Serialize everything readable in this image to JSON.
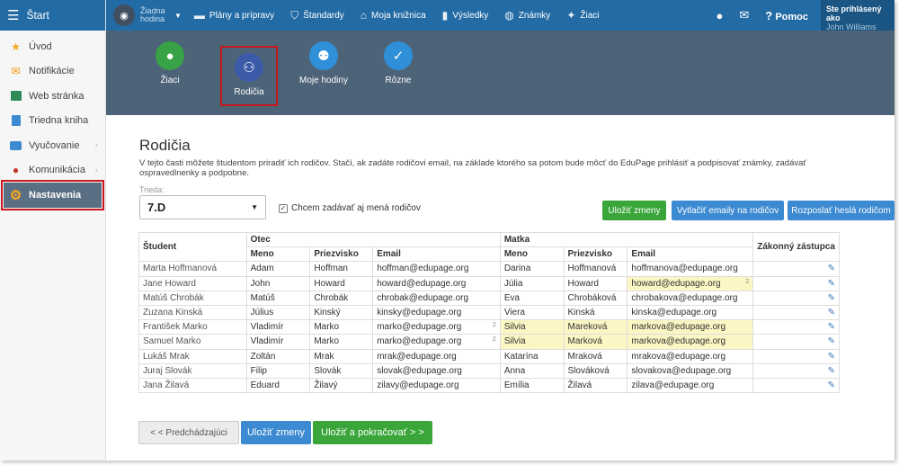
{
  "topbar": {
    "start": "Štart",
    "hour": "Žiadna hodina",
    "menu": [
      "Plány a prípravy",
      "Štandardy",
      "Moja knižnica",
      "Výsledky",
      "Známky",
      "Žiaci"
    ],
    "help": "Pomoc",
    "user_line1": "Ste prihlásený ako",
    "user_name": "John Williams"
  },
  "sidebar": {
    "items": [
      {
        "label": "Úvod",
        "icon": "star-icon",
        "color": "#f5a623"
      },
      {
        "label": "Notifikácie",
        "icon": "envelope-icon",
        "color": "#f39c12"
      },
      {
        "label": "Web stránka",
        "icon": "home-icon",
        "color": "#2e8b57"
      },
      {
        "label": "Triedna kniha",
        "icon": "book-icon",
        "color": "#3c8ad1"
      },
      {
        "label": "Vyučovanie",
        "icon": "briefcase-icon",
        "color": "#3c8ad1"
      },
      {
        "label": "Komunikácia",
        "icon": "chat-icon",
        "color": "#c0392b"
      },
      {
        "label": "Nastavenia",
        "icon": "gear-icon",
        "color": "#f5a623"
      }
    ]
  },
  "panel": {
    "buttons": [
      {
        "label": "Žiaci",
        "color": "#37a346"
      },
      {
        "label": "Rodičia",
        "color": "#3b5ba8"
      },
      {
        "label": "Moje hodiny",
        "color": "#2f8fd8"
      },
      {
        "label": "Rôzne",
        "color": "#2f8fd8"
      }
    ]
  },
  "main": {
    "title": "Rodičia",
    "description": "V tejto časti môžete študentom priradiť ich rodičov. Stačí, ak zadáte rodičovi email, na základe ktorého sa potom bude môcť do EduPage prihlásiť a podpisovať známky, zadávať ospravedlnenky a podpobne.",
    "class_label": "Trieda:",
    "class_value": "7.D",
    "checkbox_label": "Chcem zadávať aj mená rodičov",
    "save": "Uložiť zmeny",
    "print_emails": "Vytlačiť emaily na rodičov",
    "send_passwords": "Rozposlať heslá rodičom",
    "prev": "< < Predchádzajúci",
    "save_continue": "Uložiť a pokračovať > >"
  },
  "table": {
    "h_student": "Študent",
    "h_father": "Otec",
    "h_mother": "Matka",
    "h_guardian": "Zákonný zástupca",
    "h_name": "Meno",
    "h_surname": "Priezvisko",
    "h_email": "Email",
    "rows": [
      {
        "student": "Marta Hoffmanová",
        "f_name": "Adam",
        "f_sur": "Hoffman",
        "f_email": "hoffman@edupage.org",
        "f_n": "",
        "m_name": "Darina",
        "m_sur": "Hoffmanová",
        "m_email": "hoffmanova@edupage.org",
        "m_n": "",
        "hl": "none"
      },
      {
        "student": "Jane Howard",
        "f_name": "John",
        "f_sur": "Howard",
        "f_email": "howard@edupage.org",
        "f_n": "",
        "m_name": "Júlia",
        "m_sur": "Howard",
        "m_email": "howard@edupage.org",
        "m_n": "2",
        "hl": "email"
      },
      {
        "student": "Matúš Chrobák",
        "f_name": "Matúš",
        "f_sur": "Chrobák",
        "f_email": "chrobak@edupage.org",
        "f_n": "",
        "m_name": "Eva",
        "m_sur": "Chrobáková",
        "m_email": "chrobakova@edupage.org",
        "m_n": "",
        "hl": "none"
      },
      {
        "student": "Zuzana Kinská",
        "f_name": "Július",
        "f_sur": "Kinský",
        "f_email": "kinsky@edupage.org",
        "f_n": "",
        "m_name": "Viera",
        "m_sur": "Kinská",
        "m_email": "kinska@edupage.org",
        "m_n": "",
        "hl": "none"
      },
      {
        "student": "František Marko",
        "f_name": "Vladimír",
        "f_sur": "Marko",
        "f_email": "marko@edupage.org",
        "f_n": "2",
        "m_name": "Silvia",
        "m_sur": "Mareková",
        "m_email": "markova@edupage.org",
        "m_n": "",
        "hl": "all"
      },
      {
        "student": "Samuel Marko",
        "f_name": "Vladimír",
        "f_sur": "Marko",
        "f_email": "marko@edupage.org",
        "f_n": "2",
        "m_name": "Silvia",
        "m_sur": "Marková",
        "m_email": "markova@edupage.org",
        "m_n": "",
        "hl": "all"
      },
      {
        "student": "Lukáš Mrak",
        "f_name": "Zoltán",
        "f_sur": "Mrak",
        "f_email": "mrak@edupage.org",
        "f_n": "",
        "m_name": "Katarína",
        "m_sur": "Mraková",
        "m_email": "mrakova@edupage.org",
        "m_n": "",
        "hl": "none"
      },
      {
        "student": "Juraj Slovák",
        "f_name": "Filip",
        "f_sur": "Slovák",
        "f_email": "slovak@edupage.org",
        "f_n": "",
        "m_name": "Anna",
        "m_sur": "Slováková",
        "m_email": "slovakova@edupage.org",
        "m_n": "",
        "hl": "none"
      },
      {
        "student": "Jana Žilavá",
        "f_name": "Eduard",
        "f_sur": "Žilavý",
        "f_email": "zilavy@edupage.org",
        "f_n": "",
        "m_name": "Emília",
        "m_sur": "Žilavá",
        "m_email": "zilava@edupage.org",
        "m_n": "",
        "hl": "none"
      }
    ]
  }
}
